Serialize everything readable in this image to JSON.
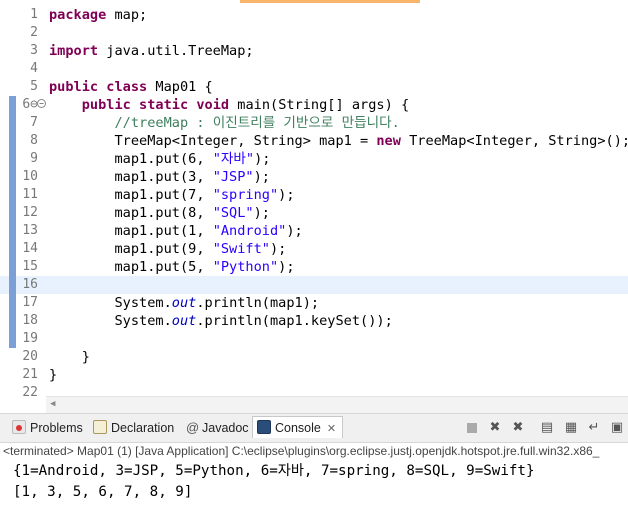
{
  "editor": {
    "lines": [
      {
        "n": "1",
        "segs": [
          {
            "c": "kw",
            "t": "package"
          },
          {
            "c": "",
            "t": " map;"
          }
        ]
      },
      {
        "n": "2",
        "segs": []
      },
      {
        "n": "3",
        "segs": [
          {
            "c": "kw",
            "t": "import"
          },
          {
            "c": "",
            "t": " java.util.TreeMap;"
          }
        ]
      },
      {
        "n": "4",
        "segs": []
      },
      {
        "n": "5",
        "segs": [
          {
            "c": "kw",
            "t": "public"
          },
          {
            "c": "",
            "t": " "
          },
          {
            "c": "kw",
            "t": "class"
          },
          {
            "c": "",
            "t": " Map01 {"
          }
        ]
      },
      {
        "n": "6⊖",
        "segs": [
          {
            "c": "",
            "t": "    "
          },
          {
            "c": "kw",
            "t": "public"
          },
          {
            "c": "",
            "t": " "
          },
          {
            "c": "kw",
            "t": "static"
          },
          {
            "c": "",
            "t": " "
          },
          {
            "c": "kw",
            "t": "void"
          },
          {
            "c": "",
            "t": " main(String[] args) {"
          }
        ]
      },
      {
        "n": "7",
        "segs": [
          {
            "c": "",
            "t": "        "
          },
          {
            "c": "cm",
            "t": "//treeMap : 이진트리를 기반으로 만듭니다."
          }
        ]
      },
      {
        "n": "8",
        "segs": [
          {
            "c": "",
            "t": "        TreeMap<Integer, String> map1 = "
          },
          {
            "c": "kw",
            "t": "new"
          },
          {
            "c": "",
            "t": " TreeMap<Integer, String>();"
          }
        ]
      },
      {
        "n": "9",
        "segs": [
          {
            "c": "",
            "t": "        map1.put(6, "
          },
          {
            "c": "st",
            "t": "\"자바\""
          },
          {
            "c": "",
            "t": ");"
          }
        ]
      },
      {
        "n": "10",
        "segs": [
          {
            "c": "",
            "t": "        map1.put(3, "
          },
          {
            "c": "st",
            "t": "\"JSP\""
          },
          {
            "c": "",
            "t": ");"
          }
        ]
      },
      {
        "n": "11",
        "segs": [
          {
            "c": "",
            "t": "        map1.put(7, "
          },
          {
            "c": "st",
            "t": "\"spring\""
          },
          {
            "c": "",
            "t": ");"
          }
        ]
      },
      {
        "n": "12",
        "segs": [
          {
            "c": "",
            "t": "        map1.put(8, "
          },
          {
            "c": "st",
            "t": "\"SQL\""
          },
          {
            "c": "",
            "t": ");"
          }
        ]
      },
      {
        "n": "13",
        "segs": [
          {
            "c": "",
            "t": "        map1.put(1, "
          },
          {
            "c": "st",
            "t": "\"Android\""
          },
          {
            "c": "",
            "t": ");"
          }
        ]
      },
      {
        "n": "14",
        "segs": [
          {
            "c": "",
            "t": "        map1.put(9, "
          },
          {
            "c": "st",
            "t": "\"Swift\""
          },
          {
            "c": "",
            "t": ");"
          }
        ]
      },
      {
        "n": "15",
        "segs": [
          {
            "c": "",
            "t": "        map1.put(5, "
          },
          {
            "c": "st",
            "t": "\"Python\""
          },
          {
            "c": "",
            "t": ");"
          }
        ]
      },
      {
        "n": "16",
        "segs": []
      },
      {
        "n": "17",
        "segs": [
          {
            "c": "",
            "t": "        System."
          },
          {
            "c": "fld",
            "t": "out"
          },
          {
            "c": "",
            "t": ".println(map1);"
          }
        ]
      },
      {
        "n": "18",
        "segs": [
          {
            "c": "",
            "t": "        System."
          },
          {
            "c": "fld",
            "t": "out"
          },
          {
            "c": "",
            "t": ".println(map1.keySet());"
          }
        ]
      },
      {
        "n": "19",
        "segs": []
      },
      {
        "n": "20",
        "segs": [
          {
            "c": "",
            "t": "    }"
          }
        ]
      },
      {
        "n": "21",
        "segs": [
          {
            "c": "",
            "t": "}"
          }
        ]
      },
      {
        "n": "22",
        "segs": []
      }
    ],
    "current_line": "16"
  },
  "console": {
    "tabs": {
      "problems": "Problems",
      "declaration": "Declaration",
      "javadoc": "Javadoc",
      "console": "Console"
    },
    "terminated": "<terminated> Map01 (1) [Java Application] C:\\eclipse\\plugins\\org.eclipse.justj.openjdk.hotspot.jre.full.win32.x86_",
    "output": [
      "{1=Android, 3=JSP, 5=Python, 6=자바, 7=spring, 8=SQL, 9=Swift}",
      "[1, 3, 5, 6, 7, 8, 9]"
    ]
  },
  "icons": {
    "problems": "problems-icon",
    "declaration": "declaration-icon",
    "javadoc": "javadoc-icon",
    "console": "console-icon"
  }
}
